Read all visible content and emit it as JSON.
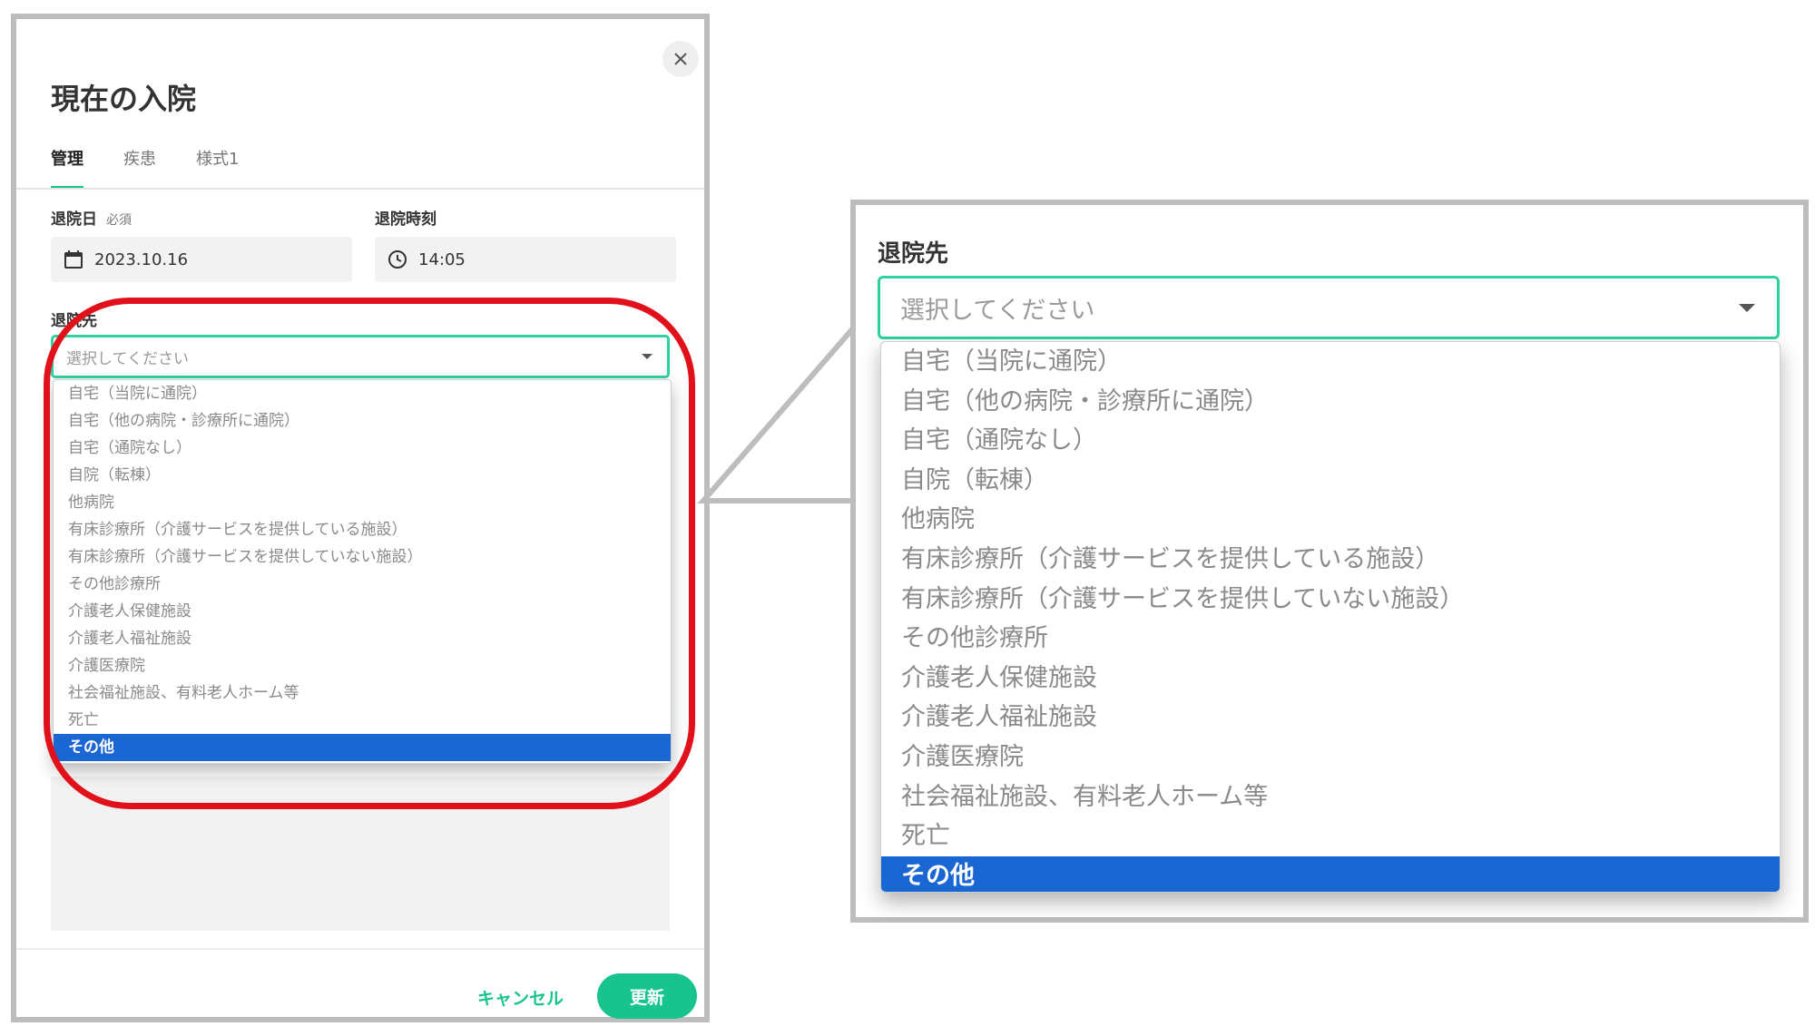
{
  "modal": {
    "title": "現在の入院",
    "tabs": [
      "管理",
      "疾患",
      "様式1"
    ],
    "discharge_date_label": "退院日",
    "required_label": "必須",
    "discharge_date_value": "2023.10.16",
    "discharge_time_label": "退院時刻",
    "discharge_time_value": "14:05",
    "destination_label": "退院先",
    "destination_placeholder": "選択してください",
    "cancel_label": "キャンセル",
    "update_label": "更新"
  },
  "destination_options": [
    "自宅（当院に通院）",
    "自宅（他の病院・診療所に通院）",
    "自宅（通院なし）",
    "自院（転棟）",
    "他病院",
    "有床診療所（介護サービスを提供している施設）",
    "有床診療所（介護サービスを提供していない施設）",
    "その他診療所",
    "介護老人保健施設",
    "介護老人福祉施設",
    "介護医療院",
    "社会福祉施設、有料老人ホーム等",
    "死亡",
    "その他"
  ],
  "selected_option": "その他",
  "colors": {
    "accent": "#19c38e",
    "selected_bg": "#1a66d2",
    "highlight": "#e0111b"
  }
}
